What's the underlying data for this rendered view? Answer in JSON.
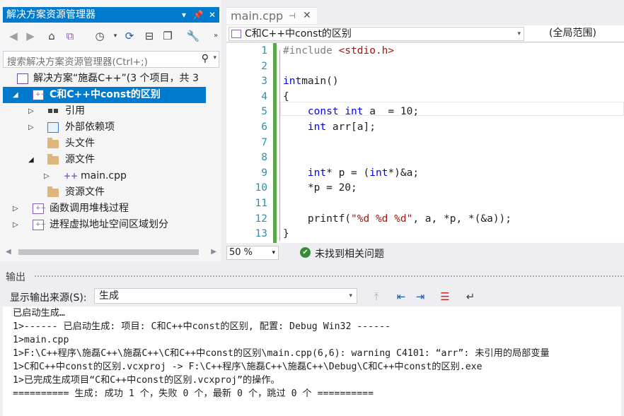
{
  "solution_explorer": {
    "title": "解决方案资源管理器",
    "pin_glyph": "▾",
    "search_placeholder": "搜索解决方案资源管理器(Ctrl+;)",
    "tree": [
      {
        "label": "解决方案“施磊C++”(3 个项目，共 3",
        "icon": "solution-icon",
        "expanded": null
      },
      {
        "label": "C和C++中const的区别",
        "icon": "cpp-project-icon",
        "expanded": true,
        "selected": true
      },
      {
        "label": "引用",
        "icon": "references-icon",
        "expanded": false
      },
      {
        "label": "外部依赖项",
        "icon": "external-dependencies-icon",
        "expanded": false
      },
      {
        "label": "头文件",
        "icon": "folder-icon",
        "expanded": null
      },
      {
        "label": "源文件",
        "icon": "folder-icon",
        "expanded": true
      },
      {
        "label": "main.cpp",
        "icon": "cpp-file-icon",
        "expanded": false
      },
      {
        "label": "资源文件",
        "icon": "folder-icon",
        "expanded": null
      },
      {
        "label": "函数调用堆栈过程",
        "icon": "cpp-project-icon",
        "expanded": false
      },
      {
        "label": "进程虚拟地址空间区域划分",
        "icon": "cpp-project-icon",
        "expanded": false
      }
    ]
  },
  "editor": {
    "tab_label": "main.cpp",
    "scope_dropdown": "C和C++中const的区别",
    "member_dropdown": "(全局范围)",
    "zoom": "50 %",
    "status_text": "未找到相关问题",
    "code_lines": [
      {
        "n": "1",
        "tokens": [
          [
            "inc",
            "#include "
          ],
          [
            "str",
            "<stdio.h>"
          ]
        ]
      },
      {
        "n": "2",
        "tokens": []
      },
      {
        "n": "3",
        "tokens": [
          [
            "kw",
            "int"
          ],
          [
            "",
            "main()"
          ]
        ]
      },
      {
        "n": "4",
        "tokens": [
          [
            "",
            "{"
          ]
        ]
      },
      {
        "n": "5",
        "tokens": [
          [
            "",
            "    "
          ],
          [
            "kw",
            "const"
          ],
          [
            "",
            " "
          ],
          [
            "kw",
            "int"
          ],
          [
            "",
            " a  = 10;"
          ]
        ]
      },
      {
        "n": "6",
        "tokens": [
          [
            "",
            "    "
          ],
          [
            "kw",
            "int"
          ],
          [
            "",
            " arr[a];"
          ]
        ]
      },
      {
        "n": "7",
        "tokens": []
      },
      {
        "n": "8",
        "tokens": []
      },
      {
        "n": "9",
        "tokens": [
          [
            "",
            "    "
          ],
          [
            "kw",
            "int"
          ],
          [
            "",
            "* p = ("
          ],
          [
            "kw",
            "int"
          ],
          [
            "",
            "*)&a;"
          ]
        ]
      },
      {
        "n": "10",
        "tokens": [
          [
            "",
            "    *p = 20;"
          ]
        ]
      },
      {
        "n": "11",
        "tokens": []
      },
      {
        "n": "12",
        "tokens": [
          [
            "",
            "    printf("
          ],
          [
            "str",
            "\"%d %d %d\""
          ],
          [
            "",
            ", a, *p, *(&a));"
          ]
        ]
      },
      {
        "n": "13",
        "tokens": [
          [
            "",
            "}"
          ]
        ]
      }
    ]
  },
  "output": {
    "title": "输出",
    "source_label": "显示输出来源(S):",
    "source_value": "生成",
    "lines": [
      "已启动生成…",
      "1>------ 已启动生成: 项目: C和C++中const的区别, 配置: Debug Win32 ------",
      "1>main.cpp",
      "1>F:\\C++程序\\施磊C++\\施磊C++\\C和C++中const的区别\\main.cpp(6,6): warning C4101: “arr”: 未引用的局部变量",
      "1>C和C++中const的区别.vcxproj -> F:\\C++程序\\施磊C++\\施磊C++\\Debug\\C和C++中const的区别.exe",
      "1>已完成生成项目“C和C++中const的区别.vcxproj”的操作。",
      "========== 生成: 成功 1 个，失败 0 个，最新 0 个，跳过 0 个 =========="
    ]
  },
  "colors": {
    "accent": "#007acc",
    "keyword": "#0000ff",
    "string": "#a31515",
    "line_number": "#2b91af",
    "change_bar": "#57a64a"
  }
}
